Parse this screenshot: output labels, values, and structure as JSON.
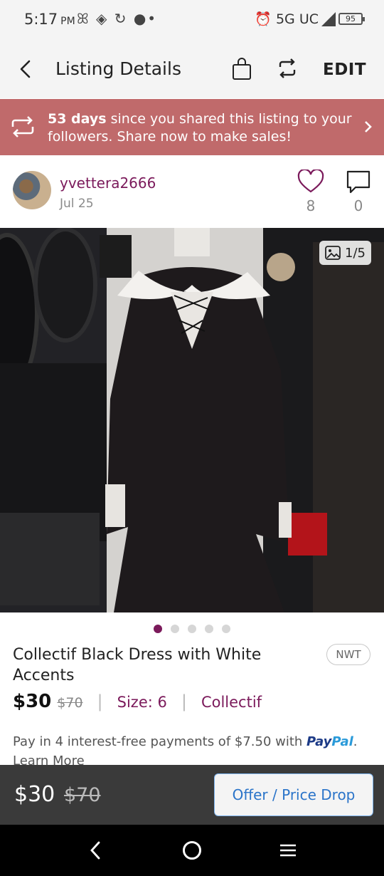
{
  "status_bar": {
    "time": "5:17",
    "ampm": "PM",
    "left_icons": "ꕤ ◈ ↻ ●•",
    "network": "⏰ 5G UC",
    "battery": "95"
  },
  "header": {
    "title": "Listing Details",
    "edit_label": "EDIT"
  },
  "share_banner": {
    "days": "53 days",
    "message": " since you shared this listing to your followers. Share now to make sales!"
  },
  "seller": {
    "username": "yvettera2666",
    "date": "Jul 25",
    "likes": "8",
    "comments": "0"
  },
  "photo": {
    "counter": "1/5",
    "total": 5,
    "current_index": 0
  },
  "listing": {
    "title": "Collectif Black Dress with White Accents",
    "condition": "NWT",
    "price": "$30",
    "original_price": "$70",
    "size": "Size: 6",
    "brand": "Collectif",
    "paypal_text": "Pay in 4 interest-free payments of $7.50 with ",
    "paypal_brand_a": "Pay",
    "paypal_brand_b": "Pal",
    "paypal_end": ".",
    "learn_more": "Learn More"
  },
  "action_bar": {
    "price": "$30",
    "original_price": "$70",
    "offer_label": "Offer / Price Drop"
  },
  "colors": {
    "accent": "#7b1a5b",
    "banner": "#c06a6b",
    "offer_blue": "#2a74c9",
    "bar_bg": "#3a3a3a"
  }
}
